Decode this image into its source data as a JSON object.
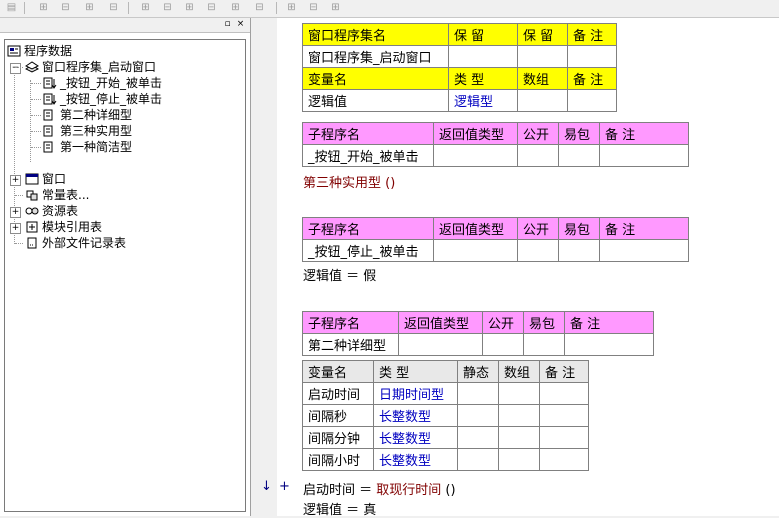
{
  "toolbar": {
    "buttons": [
      "▤",
      "⊞",
      "⊟",
      "⊞",
      "⊟",
      "⊞",
      "⊟",
      "⊞",
      "⊟",
      "⊞",
      "⊟",
      "⊞",
      "⊟",
      "⊞",
      "⊟"
    ]
  },
  "tree_pane": {
    "pin_glyph": "▫",
    "close_glyph": "×",
    "nodes": [
      {
        "label": "程序数据",
        "icon": "program-data-icon",
        "expander": "−"
      },
      {
        "label": "窗口程序集_启动窗口",
        "icon": "class-module-icon",
        "expander": "−"
      },
      {
        "label": "_按钮_开始_被单击",
        "icon": "sub-program-icon"
      },
      {
        "label": "_按钮_停止_被单击",
        "icon": "sub-program-icon"
      },
      {
        "label": "第二种详细型",
        "icon": "sub-program-icon"
      },
      {
        "label": "第三种实用型",
        "icon": "sub-program-icon"
      },
      {
        "label": "第一种简洁型",
        "icon": "sub-program-icon"
      },
      {
        "label": "窗口",
        "icon": "window-icon",
        "expander": "+"
      },
      {
        "label": "常量表...",
        "icon": "constant-table-icon"
      },
      {
        "label": "资源表",
        "icon": "resource-table-icon",
        "expander": "+"
      },
      {
        "label": "模块引用表",
        "icon": "module-ref-icon",
        "expander": "+"
      },
      {
        "label": "外部文件记录表",
        "icon": "external-file-icon"
      }
    ]
  },
  "editor": {
    "assembly_table": {
      "headers": [
        "窗口程序集名",
        "保 留",
        "保 留",
        "备 注"
      ],
      "row": [
        "窗口程序集_启动窗口",
        "",
        "",
        ""
      ],
      "var_headers": [
        "变量名",
        "类 型",
        "数组",
        "备 注"
      ],
      "var_row": [
        "逻辑值",
        "逻辑型",
        "",
        ""
      ]
    },
    "sub1": {
      "headers": [
        "子程序名",
        "返回值类型",
        "公开",
        "易包",
        "备 注"
      ],
      "row": [
        "_按钮_开始_被单击",
        "",
        "",
        "",
        ""
      ],
      "code": [
        "第三种实用型 ()"
      ]
    },
    "sub2": {
      "headers": [
        "子程序名",
        "返回值类型",
        "公开",
        "易包",
        "备 注"
      ],
      "row": [
        "_按钮_停止_被单击",
        "",
        "",
        "",
        ""
      ],
      "code": [
        "逻辑值 ＝ 假"
      ]
    },
    "sub3": {
      "headers": [
        "子程序名",
        "返回值类型",
        "公开",
        "易包",
        "备 注"
      ],
      "row": [
        "第二种详细型",
        "",
        "",
        "",
        ""
      ],
      "local_headers": [
        "变量名",
        "类 型",
        "静态",
        "数组",
        "备 注"
      ],
      "locals": [
        [
          "启动时间",
          "日期时间型",
          "",
          "",
          ""
        ],
        [
          "间隔秒",
          "长整数型",
          "",
          "",
          ""
        ],
        [
          "间隔分钟",
          "长整数型",
          "",
          "",
          ""
        ],
        [
          "间隔小时",
          "长整数型",
          "",
          "",
          ""
        ]
      ],
      "code_line_1": {
        "var": "启动时间",
        "op": " ＝ ",
        "call": "取现行时间",
        "tail": " ()"
      },
      "code_line_2": "逻辑值 ＝ 真",
      "gutter_arrow": "↓",
      "gutter_plus": "+"
    }
  },
  "colors": {
    "yellow_header": "#ffff00",
    "pink_header": "#ff99ff",
    "type_blue": "#0000c0",
    "call_maroon": "#800000"
  }
}
